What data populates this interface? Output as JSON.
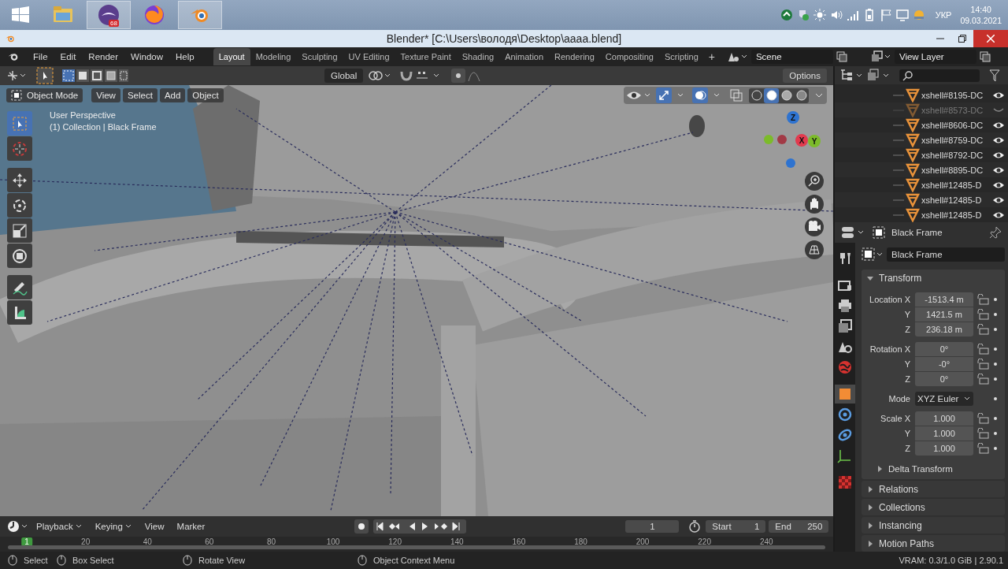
{
  "taskbar": {
    "apps": [
      {
        "kind": "folder",
        "active": false
      },
      {
        "kind": "chat",
        "active": true,
        "badge": "68"
      },
      {
        "kind": "browser",
        "active": false
      },
      {
        "kind": "blender",
        "active": true
      }
    ],
    "language": "УКР",
    "time": "14:40",
    "date": "09.03.2021"
  },
  "window": {
    "title": "Blender* [C:\\Users\\володя\\Desktop\\aaaa.blend]"
  },
  "menu": [
    "File",
    "Edit",
    "Render",
    "Window",
    "Help"
  ],
  "workspaces": [
    {
      "label": "Layout",
      "selected": true
    },
    {
      "label": "Modeling",
      "selected": false
    },
    {
      "label": "Sculpting",
      "selected": false
    },
    {
      "label": "UV Editing",
      "selected": false
    },
    {
      "label": "Texture Paint",
      "selected": false
    },
    {
      "label": "Shading",
      "selected": false
    },
    {
      "label": "Animation",
      "selected": false
    },
    {
      "label": "Rendering",
      "selected": false
    },
    {
      "label": "Compositing",
      "selected": false
    },
    {
      "label": "Scripting",
      "selected": false
    }
  ],
  "add_workspace": "+",
  "scene": "Scene",
  "view_layer": "View Layer",
  "tool_header": {
    "orientation": "Global",
    "options": "Options"
  },
  "viewport": {
    "mode": "Object Mode",
    "menus": [
      "View",
      "Select",
      "Add",
      "Object"
    ],
    "perspective": "User Perspective",
    "context": "(1) Collection | Black Frame",
    "tools": [
      {
        "kind": "select",
        "selected": true
      },
      {
        "kind": "cursor",
        "selected": false
      },
      {
        "kind": "move",
        "selected": false
      },
      {
        "kind": "rotate",
        "selected": false
      },
      {
        "kind": "scale",
        "selected": false
      },
      {
        "kind": "transform",
        "selected": false
      },
      {
        "kind": "annotate",
        "selected": false
      },
      {
        "kind": "measure",
        "selected": false
      }
    ],
    "shading": [
      {
        "kind": "wireframe",
        "selected": false
      },
      {
        "kind": "solid",
        "selected": true
      },
      {
        "kind": "material",
        "selected": false
      },
      {
        "kind": "rendered",
        "selected": false
      }
    ],
    "axes": [
      {
        "label": "Z",
        "color": "#2e73d0"
      },
      {
        "label": "X",
        "color": "#e23a4e"
      },
      {
        "label": "Y",
        "color": "#7cbb2a"
      }
    ]
  },
  "outliner": {
    "items": [
      {
        "name": "xshell#8195-DC",
        "visible": true
      },
      {
        "name": "xshell#8573-DC",
        "visible": false
      },
      {
        "name": "xshell#8606-DC",
        "visible": true
      },
      {
        "name": "xshell#8759-DC",
        "visible": true
      },
      {
        "name": "xshell#8792-DC",
        "visible": true
      },
      {
        "name": "xshell#8895-DC",
        "visible": true
      },
      {
        "name": "xshell#12485-D",
        "visible": true
      },
      {
        "name": "xshell#12485-D",
        "visible": true
      },
      {
        "name": "xshell#12485-D",
        "visible": true
      }
    ]
  },
  "properties": {
    "tabs": [
      {
        "kind": "tool",
        "selected": false
      },
      {
        "kind": "render",
        "selected": false
      },
      {
        "kind": "output",
        "selected": false
      },
      {
        "kind": "view_layer",
        "selected": false
      },
      {
        "kind": "scene",
        "selected": false
      },
      {
        "kind": "world",
        "selected": false
      },
      {
        "kind": "object",
        "selected": true
      },
      {
        "kind": "modifier",
        "selected": false
      },
      {
        "kind": "physics",
        "selected": false
      },
      {
        "kind": "data",
        "selected": false
      },
      {
        "kind": "texture",
        "selected": false
      }
    ],
    "object_name": "Black Frame",
    "data_name": "Black Frame",
    "transform": {
      "title": "Transform",
      "expanded": true,
      "groups": [
        {
          "kind": "vector",
          "rows": [
            {
              "label": "Location X",
              "value": "-1513.4 m"
            },
            {
              "label": "Y",
              "value": "1421.5 m"
            },
            {
              "label": "Z",
              "value": "236.18 m"
            }
          ]
        },
        {
          "kind": "vector",
          "rows": [
            {
              "label": "Rotation X",
              "value": "0°"
            },
            {
              "label": "Y",
              "value": "-0°"
            },
            {
              "label": "Z",
              "value": "0°"
            }
          ]
        },
        {
          "kind": "dropdown",
          "label": "Mode",
          "value": "XYZ Euler"
        },
        {
          "kind": "vector",
          "rows": [
            {
              "label": "Scale X",
              "value": "1.000"
            },
            {
              "label": "Y",
              "value": "1.000"
            },
            {
              "label": "Z",
              "value": "1.000"
            }
          ]
        }
      ],
      "subpanel": {
        "title": "Delta Transform",
        "expanded": false
      }
    },
    "panels": [
      {
        "title": "Relations",
        "expanded": false
      },
      {
        "title": "Collections",
        "expanded": false
      },
      {
        "title": "Instancing",
        "expanded": false
      },
      {
        "title": "Motion Paths",
        "expanded": false
      }
    ]
  },
  "timeline": {
    "menus": [
      {
        "label": "Playback",
        "dropdown": true
      },
      {
        "label": "Keying",
        "dropdown": true
      },
      {
        "label": "View",
        "dropdown": false
      },
      {
        "label": "Marker",
        "dropdown": false
      }
    ],
    "frame": "1",
    "start_label": "Start",
    "start": "1",
    "end_label": "End",
    "end": "250",
    "ruler": [
      {
        "label": "1",
        "current": true
      },
      {
        "label": "20",
        "current": false
      },
      {
        "label": "40",
        "current": false
      },
      {
        "label": "60",
        "current": false
      },
      {
        "label": "80",
        "current": false
      },
      {
        "label": "100",
        "current": false
      },
      {
        "label": "120",
        "current": false
      },
      {
        "label": "140",
        "current": false
      },
      {
        "label": "160",
        "current": false
      },
      {
        "label": "180",
        "current": false
      },
      {
        "label": "200",
        "current": false
      },
      {
        "label": "220",
        "current": false
      },
      {
        "label": "240",
        "current": false
      }
    ]
  },
  "status_bar": {
    "hints": [
      "Select",
      "Box Select",
      "Rotate View",
      "Object Context Menu"
    ],
    "info": "VRAM: 0.3/1.0 GiB | 2.90.1"
  }
}
